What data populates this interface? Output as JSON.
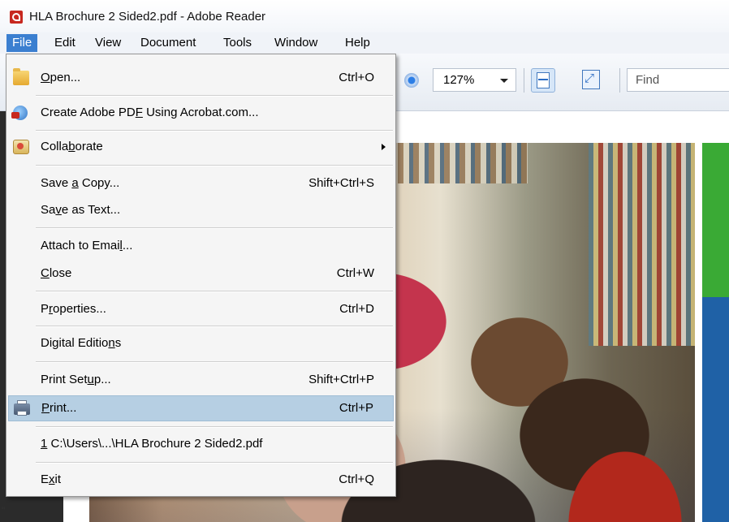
{
  "window": {
    "title": "HLA Brochure 2 Sided2.pdf - Adobe Reader"
  },
  "menubar": [
    "File",
    "Edit",
    "View",
    "Document",
    "Tools",
    "Window",
    "Help"
  ],
  "toolbar": {
    "zoom_value": "127%",
    "find_placeholder": "Find"
  },
  "file_menu": {
    "open": {
      "pre": "",
      "u": "O",
      "post": "pen...",
      "shortcut": "Ctrl+O"
    },
    "create_pdf": {
      "pre": "Create Adobe PD",
      "u": "F",
      "post": " Using Acrobat.com...",
      "shortcut": ""
    },
    "collaborate": {
      "pre": "Colla",
      "u": "b",
      "post": "orate",
      "shortcut": ""
    },
    "save_copy": {
      "pre": "Save ",
      "u": "a",
      "post": " Copy...",
      "shortcut": "Shift+Ctrl+S"
    },
    "save_text": {
      "pre": "Sa",
      "u": "v",
      "post": "e as Text...",
      "shortcut": ""
    },
    "attach_email": {
      "pre": "Attach to Emai",
      "u": "l",
      "post": "...",
      "shortcut": ""
    },
    "close": {
      "pre": "",
      "u": "C",
      "post": "lose",
      "shortcut": "Ctrl+W"
    },
    "properties": {
      "pre": "P",
      "u": "r",
      "post": "operties...",
      "shortcut": "Ctrl+D"
    },
    "digital_editions": {
      "pre": "Digital Editio",
      "u": "n",
      "post": "s",
      "shortcut": ""
    },
    "print_setup": {
      "pre": "Print Set",
      "u": "u",
      "post": "p...",
      "shortcut": "Shift+Ctrl+P"
    },
    "print": {
      "pre": "",
      "u": "P",
      "post": "rint...",
      "shortcut": "Ctrl+P"
    },
    "recent": {
      "pre": "",
      "u": "1",
      "post": " C:\\Users\\...\\HLA Brochure 2 Sided2.pdf",
      "shortcut": ""
    },
    "exit": {
      "pre": "E",
      "u": "x",
      "post": "it",
      "shortcut": "Ctrl+Q"
    }
  },
  "icons": {
    "pdf": "adobe-pdf-icon",
    "open": "folder-icon",
    "create": "acrobat-globe-icon",
    "collaborate": "collaborate-icon",
    "print": "printer-icon",
    "zoom_in": "zoom-in-icon",
    "fit_width": "fit-width-icon",
    "full_screen": "full-screen-icon"
  },
  "colors": {
    "menu_active": "#3b7fd0",
    "menu_highlight": "#b6cfe3",
    "brochure_green": "#3aaa35",
    "brochure_blue": "#1f61a6"
  },
  "misc": {
    "edge_mark": "\""
  }
}
